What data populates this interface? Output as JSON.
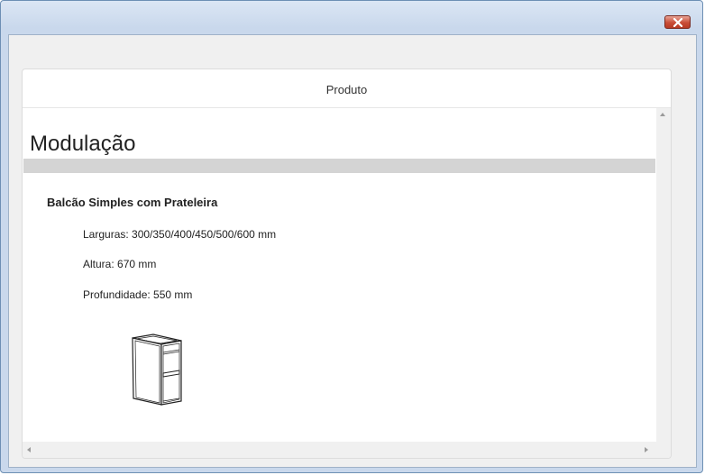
{
  "window": {
    "close_icon": "close-x-icon",
    "accent_color": "#c94d37"
  },
  "panel": {
    "header_title": "Produto"
  },
  "content": {
    "heading": "Modulação",
    "product_name": "Balcão Simples com Prateleira",
    "specs": [
      "Larguras: 300/350/400/450/500/600 mm",
      "Altura: 670 mm",
      "Profundidade: 550 mm"
    ],
    "image_icon": "cabinet-with-shelf-drawing"
  },
  "scrollbars": {
    "vertical": "scroll-up-arrow",
    "horizontal": [
      "scroll-left-arrow",
      "scroll-right-arrow"
    ]
  }
}
